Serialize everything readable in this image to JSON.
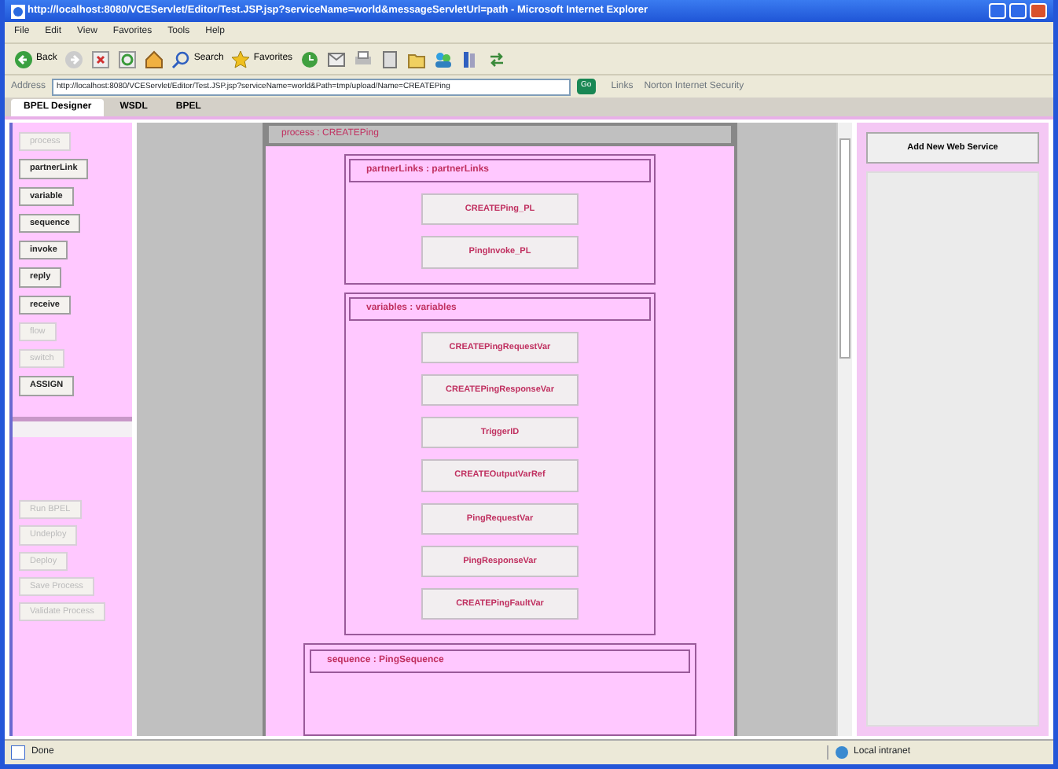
{
  "window": {
    "title": "http://localhost:8080/VCEServlet/Editor/Test.JSP.jsp?serviceName=world&messageServletUrl=path - Microsoft Internet Explorer"
  },
  "menu": [
    "File",
    "Edit",
    "View",
    "Favorites",
    "Tools",
    "Help"
  ],
  "toolbar": [
    {
      "kind": "back",
      "label": "Back"
    },
    {
      "kind": "forward"
    },
    {
      "kind": "stop"
    },
    {
      "kind": "refresh"
    },
    {
      "kind": "home"
    },
    {
      "kind": "search",
      "label": "Search"
    },
    {
      "kind": "favorites",
      "label": "Favorites"
    },
    {
      "kind": "history"
    },
    {
      "kind": "mail"
    },
    {
      "kind": "print"
    },
    {
      "kind": "edit"
    },
    {
      "kind": "folder"
    },
    {
      "kind": "messenger"
    },
    {
      "kind": "research"
    },
    {
      "kind": "links"
    }
  ],
  "address": {
    "label": "Address",
    "value": "http://localhost:8080/VCEServlet/Editor/Test.JSP.jsp?serviceName=world&Path=tmp/upload/Name=CREATEPing",
    "go": "Go",
    "links": "Links",
    "search_hint": "Norton Internet Security"
  },
  "tabs": [
    {
      "label": "BPEL Designer",
      "selected": true
    },
    {
      "label": "WSDL",
      "selected": false
    },
    {
      "label": "BPEL",
      "selected": false
    }
  ],
  "palette": [
    {
      "label": "process",
      "disabled": true
    },
    {
      "label": "partnerLink",
      "disabled": false
    },
    {
      "label": "variable",
      "disabled": false
    },
    {
      "label": "sequence",
      "disabled": false
    },
    {
      "label": "invoke",
      "disabled": false
    },
    {
      "label": "reply",
      "disabled": false
    },
    {
      "label": "receive",
      "disabled": false
    },
    {
      "label": "flow",
      "disabled": true
    },
    {
      "label": "switch",
      "disabled": true
    },
    {
      "label": "ASSIGN",
      "disabled": false
    }
  ],
  "actions": [
    {
      "label": "Run BPEL",
      "disabled": true
    },
    {
      "label": "Undeploy",
      "disabled": true
    },
    {
      "label": "Deploy",
      "disabled": true
    },
    {
      "label": "Save Process",
      "disabled": true
    },
    {
      "label": "Validate Process",
      "disabled": true
    }
  ],
  "canvas": {
    "title": "process : CREATEPing",
    "blocks": [
      {
        "title": "partnerLinks : partnerLinks",
        "items": [
          "CREATEPing_PL",
          "PingInvoke_PL"
        ]
      },
      {
        "title": "variables : variables",
        "items": [
          "CREATEPingRequestVar",
          "CREATEPingResponseVar",
          "TriggerID",
          "CREATEOutputVarRef",
          "PingRequestVar",
          "PingResponseVar",
          "CREATEPingFaultVar"
        ]
      }
    ],
    "sequence": {
      "title": "sequence : PingSequence"
    }
  },
  "add_button": "Add New Web Service",
  "status": {
    "text": "Done",
    "zone": "Local intranet"
  }
}
